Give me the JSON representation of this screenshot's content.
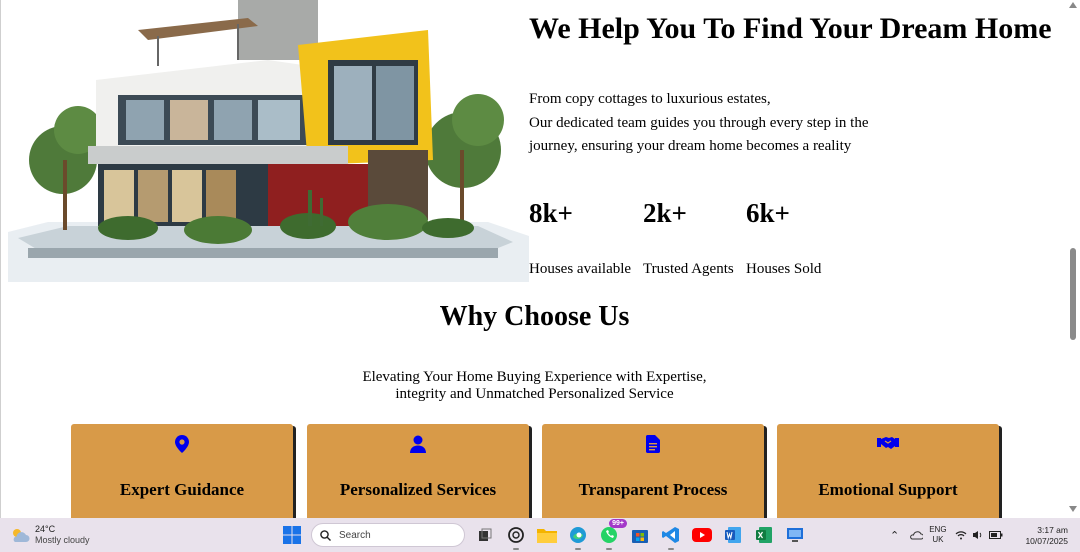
{
  "hero": {
    "title": "We Help You To Find Your Dream Home",
    "description": [
      "From copy cottages to luxurious estates,",
      "Our dedicated team guides you through every step in the",
      "journey, ensuring your dream home becomes a reality"
    ],
    "stats": [
      {
        "value": "8k+",
        "label": "Houses available"
      },
      {
        "value": "2k+",
        "label": "Trusted Agents"
      },
      {
        "value": "6k+",
        "label": "Houses Sold"
      }
    ]
  },
  "why": {
    "title": "Why Choose Us",
    "subtitle": [
      "Elevating Your Home Buying Experience with Expertise,",
      "integrity and Unmatched Personalized Service"
    ],
    "cards": [
      {
        "title": "Expert Guidance",
        "icon": "location-pin-icon"
      },
      {
        "title": "Personalized Services",
        "icon": "user-icon"
      },
      {
        "title": "Transparent Process",
        "icon": "document-icon"
      },
      {
        "title": "Emotional Support",
        "icon": "handshake-icon"
      }
    ],
    "card_color": "#d89a48",
    "icon_color": "#0000ee"
  },
  "taskbar": {
    "weather": {
      "temp": "24°C",
      "condition": "Mostly cloudy"
    },
    "search_placeholder": "Search",
    "whatsapp_badge": "99+",
    "language": {
      "line1": "ENG",
      "line2": "UK"
    },
    "clock": {
      "time": "3:17 am",
      "date": "10/07/2025"
    }
  }
}
